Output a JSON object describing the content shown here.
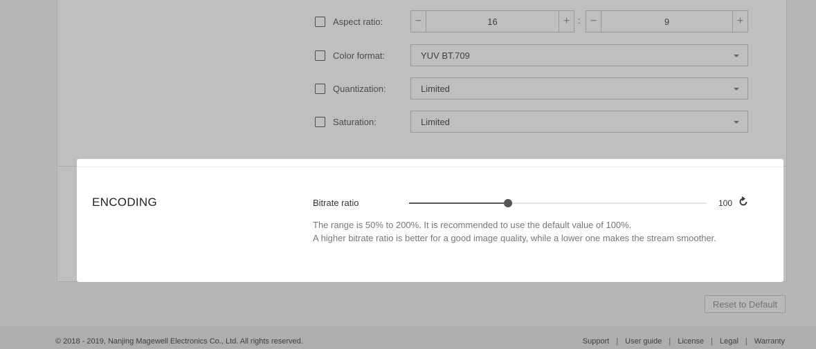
{
  "video_settings": {
    "aspect_ratio": {
      "label": "Aspect ratio:",
      "width": "16",
      "height": "9",
      "minus": "−",
      "plus": "+",
      "separator": ":"
    },
    "color_format": {
      "label": "Color format:",
      "value": "YUV BT.709"
    },
    "quantization": {
      "label": "Quantization:",
      "value": "Limited"
    },
    "saturation": {
      "label": "Saturation:",
      "value": "Limited"
    }
  },
  "encoding": {
    "title": "ENCODING",
    "bitrate_label": "Bitrate ratio",
    "bitrate_value": "100",
    "bitrate_min": 50,
    "bitrate_max": 200,
    "help_line1": "The range is 50% to 200%. It is recommended to use the default value of 100%.",
    "help_line2": "A higher bitrate ratio is better for a good image quality, while a lower one makes the stream smoother."
  },
  "reset_default_label": "Reset to Default",
  "footer": {
    "copyright": "© 2018 - 2019, Nanjing Magewell Electronics Co., Ltd. All rights reserved.",
    "links": [
      "Support",
      "User guide",
      "License",
      "Legal",
      "Warranty"
    ],
    "separator": "|"
  },
  "icons": {
    "reset": "refresh-icon",
    "dropdown": "chevron-down-icon"
  },
  "colors": {
    "overlay": "#00000040",
    "slider": "#555555",
    "panel_bg": "#ffffff"
  }
}
